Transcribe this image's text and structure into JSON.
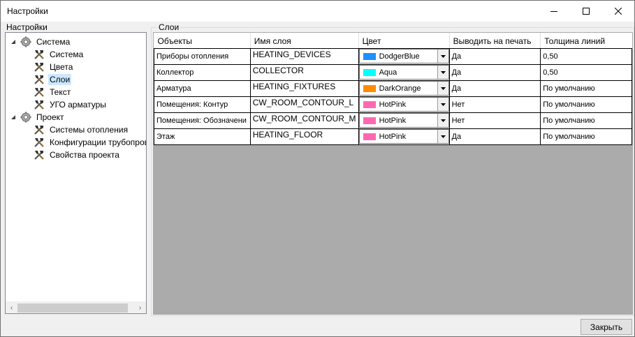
{
  "window": {
    "title": "Настройки"
  },
  "titlebar_buttons": {
    "minimize": "minimize-icon",
    "maximize": "maximize-icon",
    "close": "close-icon"
  },
  "sidebar": {
    "group_label": "Настройки",
    "tree": [
      {
        "label": "Система",
        "icon": "gear-icon",
        "expanded": true
      },
      {
        "label": "Система",
        "icon": "tools-icon"
      },
      {
        "label": "Цвета",
        "icon": "tools-icon"
      },
      {
        "label": "Слои",
        "icon": "tools-icon",
        "selected": true
      },
      {
        "label": "Текст",
        "icon": "tools-icon"
      },
      {
        "label": "УГО арматуры",
        "icon": "tools-icon"
      },
      {
        "label": "Проект",
        "icon": "gear-icon",
        "expanded": true
      },
      {
        "label": "Системы отопления",
        "icon": "tools-icon"
      },
      {
        "label": "Конфигурации трубопрово",
        "icon": "tools-icon"
      },
      {
        "label": "Свойства проекта",
        "icon": "tools-icon"
      }
    ]
  },
  "main": {
    "group_label": "Слои",
    "columns": [
      "Объекты",
      "Имя слоя",
      "Цвет",
      "Выводить на печать",
      "Толщина линий"
    ],
    "rows": [
      {
        "object": "Приборы отопления",
        "layer": "HEATING_DEVICES",
        "color_name": "DodgerBlue",
        "color": "#1e90ff",
        "print": "Да",
        "thickness": "0,50"
      },
      {
        "object": "Коллектор",
        "layer": "COLLECTOR",
        "color_name": "Aqua",
        "color": "#00ffff",
        "print": "Да",
        "thickness": "0,50"
      },
      {
        "object": "Арматура",
        "layer": "HEATING_FIXTURES",
        "color_name": "DarkOrange",
        "color": "#ff8c00",
        "print": "Да",
        "thickness": "По умолчанию"
      },
      {
        "object": "Помещения: Контур",
        "layer": "CW_ROOM_CONTOUR_L",
        "color_name": "HotPink",
        "color": "#ff69b4",
        "print": "Нет",
        "thickness": "По умолчанию"
      },
      {
        "object": "Помещения: Обозначени",
        "layer": "CW_ROOM_CONTOUR_M",
        "color_name": "HotPink",
        "color": "#ff69b4",
        "print": "Нет",
        "thickness": "По умолчанию"
      },
      {
        "object": "Этаж",
        "layer": "HEATING_FLOOR",
        "color_name": "HotPink",
        "color": "#ff69b4",
        "print": "Да",
        "thickness": "По умолчанию"
      }
    ]
  },
  "footer": {
    "close_label": "Закрыть"
  }
}
